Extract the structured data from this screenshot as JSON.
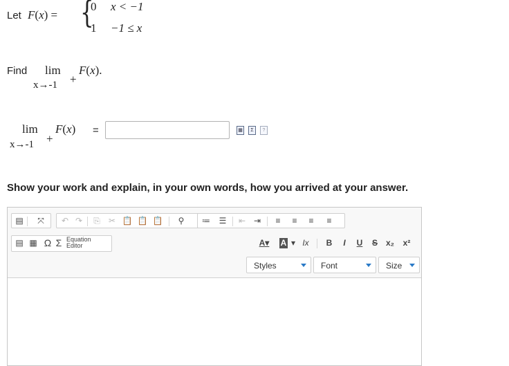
{
  "problem": {
    "let_label": "Let",
    "func": "F",
    "var": "x",
    "case1_value": "0",
    "case1_cond": "x < −1",
    "case2_value": "1",
    "case2_cond": "−1 ≤ x",
    "find_label": "Find",
    "lim": "lim",
    "lim_sub": "x→-1",
    "lim_sup": "+",
    "period": "."
  },
  "answer": {
    "lim": "lim",
    "lim_sub": "x→-1",
    "lim_sup": "+",
    "equals": "=",
    "value": ""
  },
  "prompt": "Show your work and explain, in your own words, how you arrived at your answer.",
  "editor": {
    "equation_editor_line1": "Equation",
    "equation_editor_line2": "Editor",
    "styles_label": "Styles",
    "font_label": "Font",
    "size_label": "Size",
    "content": ""
  },
  "colors": {
    "accent": "#2a7ac7"
  }
}
